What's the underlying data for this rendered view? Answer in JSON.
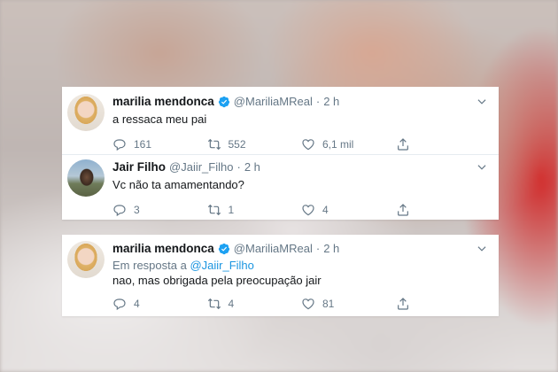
{
  "card1": {
    "tweet1": {
      "name": "marilia mendonca",
      "handle": "@MariliaMReal",
      "dot": "·",
      "time": "2 h",
      "text": "a ressaca meu pai",
      "replies": "161",
      "retweets": "552",
      "likes": "6,1 mil"
    },
    "tweet2": {
      "name": "Jair Filho",
      "handle": "@Jaiir_Filho",
      "dot": "·",
      "time": "2 h",
      "text": "Vc não ta amamentando?",
      "replies": "3",
      "retweets": "1",
      "likes": "4"
    }
  },
  "card2": {
    "tweet3": {
      "name": "marilia mendonca",
      "handle": "@MariliaMReal",
      "dot": "·",
      "time": "2 h",
      "reply_prefix": "Em resposta a",
      "reply_mention": "@Jaiir_Filho",
      "text": "nao, mas obrigada pela preocupação jair",
      "replies": "4",
      "retweets": "4",
      "likes": "81"
    }
  },
  "colors": {
    "verified": "#1da1f2",
    "secondary_text": "#657786",
    "mention": "#1b95e0",
    "primary_text": "#14171a"
  },
  "icons": [
    "verified-badge-icon",
    "chevron-down-icon",
    "reply-icon",
    "retweet-icon",
    "like-icon",
    "share-icon"
  ]
}
